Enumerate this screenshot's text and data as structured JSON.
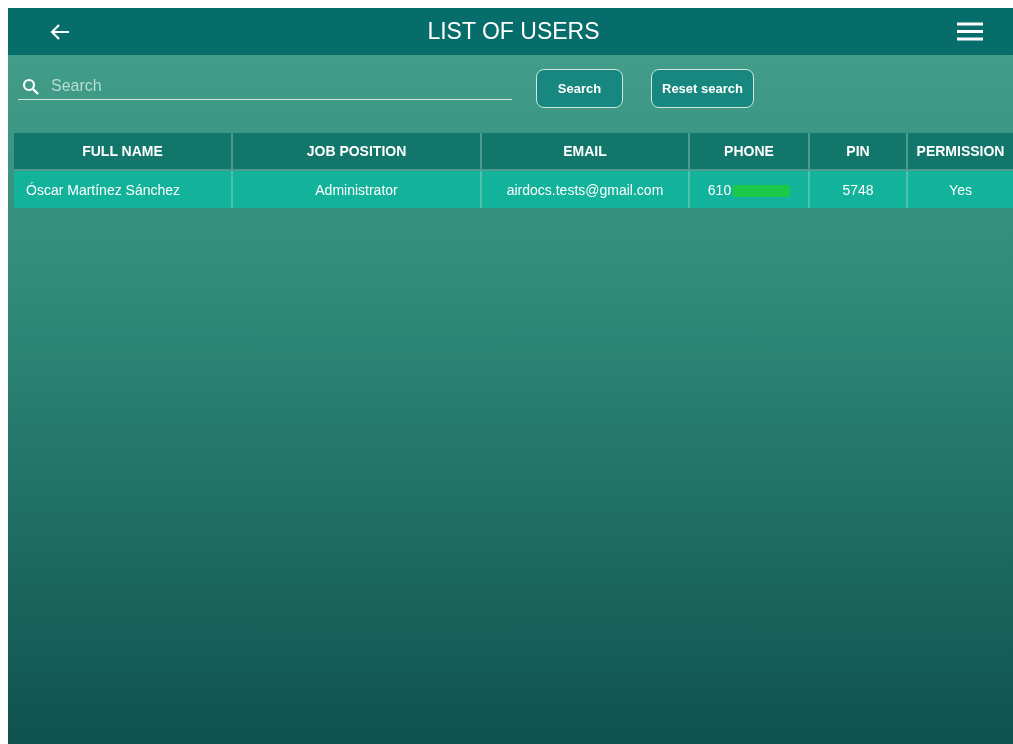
{
  "header": {
    "title": "LIST OF USERS"
  },
  "search": {
    "placeholder": "Search",
    "buttons": [
      "Search",
      "Reset search"
    ]
  },
  "table": {
    "columns": [
      "FULL NAME",
      "JOB POSITION",
      "EMAIL",
      "PHONE",
      "PIN",
      "PERMISSION"
    ],
    "rows": [
      {
        "cells": [
          "Óscar Martínez Sánchez",
          "Administrator",
          "airdocs.tests@gmail.com",
          "610",
          "5748",
          "Yes"
        ]
      }
    ]
  }
}
